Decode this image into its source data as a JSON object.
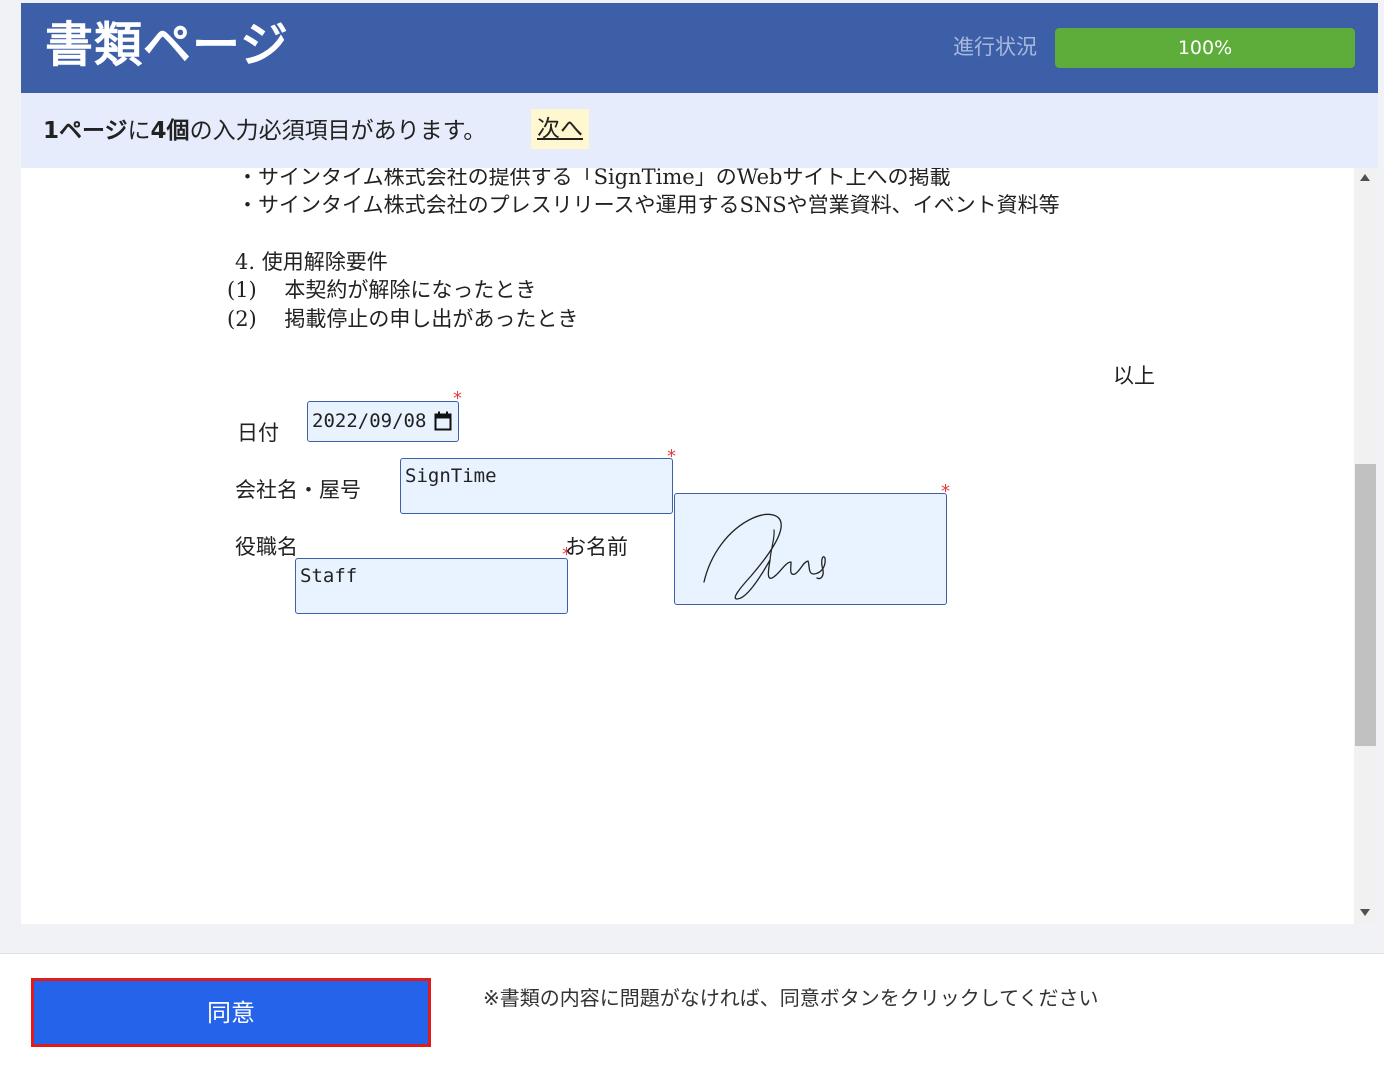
{
  "header": {
    "title": "書類ページ",
    "progress_label": "進行状況",
    "progress_text": "100%",
    "progress_fraction": 1.0
  },
  "notice": {
    "page_count": "1ページ",
    "particle": "に",
    "field_count": "4個",
    "rest": "の入力必須項目があります。",
    "next_link": "次へ"
  },
  "document": {
    "lines": [
      "・サインタイム株式会社の提供する「SignTime」のWebサイト上への掲載",
      "・サインタイム株式会社のプレスリリースや運用するSNSや営業資料、イベント資料等",
      "4. 使用解除要件",
      "(1)　 本契約が解除になったとき",
      "(2)　 掲載停止の申し出があったとき"
    ],
    "closing": "以上",
    "labels": {
      "date": "日付",
      "company": "会社名・屋号",
      "position": "役職名",
      "name": "お名前"
    },
    "fields": {
      "date_value": "2022/09/08",
      "company_value": "SignTime",
      "position_value": "Staff"
    },
    "required_mark": "*"
  },
  "footer": {
    "agree_button": "同意",
    "note": "※書類の内容に問題がなければ、同意ボタンをクリックしてください"
  },
  "colors": {
    "header_bg": "#3d5fa8",
    "progress_fill": "#5ead3b",
    "notice_bg": "#e6ecfb",
    "field_bg": "#e9f3ff",
    "required": "#e53b3b",
    "agree_bg": "#2563eb",
    "agree_border": "#e01b1b"
  },
  "icons": [
    "calendar-icon",
    "scroll-up-arrow-icon",
    "scroll-down-arrow-icon"
  ]
}
